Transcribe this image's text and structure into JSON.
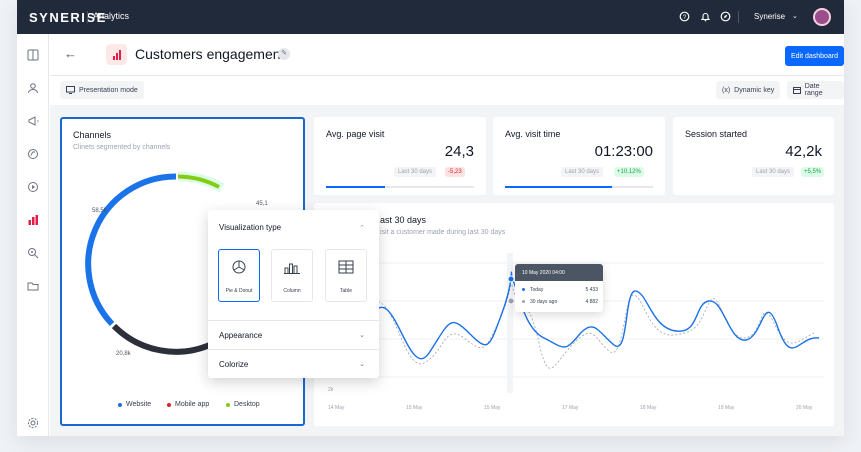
{
  "app": {
    "logo": "SYNERISE",
    "name": "Analytics"
  },
  "topbar": {
    "help_icon": "help-icon",
    "notification_icon": "bell-icon",
    "compass_icon": "compass-icon",
    "user_label": "Synerise",
    "user_chevron": "⌄"
  },
  "sidebar": {
    "items": [
      "dashboard-icon",
      "user-icon",
      "campaign-icon",
      "settings-alt-icon",
      "play-icon",
      "analytics-icon",
      "search-icon",
      "folder-icon",
      "gear-icon"
    ],
    "active_index": 5
  },
  "header": {
    "back_icon": "←",
    "title": "Customers engagement",
    "edit_icon": "✎",
    "edit_dashboard": "Edit dashboard"
  },
  "toolbar": {
    "presentation_mode": "Presentation mode",
    "dynamic_key": "Dynamic key",
    "dynamic_key_icon": "(x)",
    "date_range": "Date range"
  },
  "channels": {
    "title": "Channels",
    "subtitle": "Clinets segmented by channels",
    "labels": {
      "website": "58,5k",
      "desktop": "45,1",
      "mobile": "20,8k"
    },
    "legend": [
      "Website",
      "Mobile app",
      "Desktop"
    ]
  },
  "kpis": [
    {
      "title": "Avg. page visit",
      "value": "24,3",
      "period": "Last 30 days",
      "change": "-5,23",
      "trend": "down",
      "progress": 0.4
    },
    {
      "title": "Avg. visit time",
      "value": "01:23:00",
      "period": "Last 30 days",
      "change": "+10,12%",
      "trend": "up",
      "progress": 0.72
    },
    {
      "title": "Session started",
      "value": "42,2k",
      "period": "Last 30 days",
      "change": "+5,5%",
      "trend": "up",
      "progress": 0
    }
  ],
  "line_chart": {
    "title_fragment": "ast 30 days",
    "subtitle_fragment": "isit a customer made during last 30 days",
    "y_tick": "2k",
    "x_labels": [
      "14 May",
      "15 May",
      "15 May",
      "17 May",
      "18 May",
      "19 May",
      "20 May"
    ]
  },
  "tooltip": {
    "header": "10 May 2020 04:00",
    "rows": [
      {
        "label": "Today",
        "value": "5 433"
      },
      {
        "label": "30 days ago",
        "value": "4 882"
      }
    ]
  },
  "visualization_popup": {
    "title": "Visualization type",
    "chevron_up": "⌃",
    "options": [
      {
        "label": "Pie & Donut",
        "icon": "pie-chart-icon",
        "selected": true
      },
      {
        "label": "Column",
        "icon": "column-chart-icon",
        "selected": false
      },
      {
        "label": "Table",
        "icon": "table-icon",
        "selected": false
      }
    ],
    "appearance": "Appearance",
    "colorize": "Colorize",
    "chevron_down": "⌄"
  },
  "colors": {
    "accent": "#0b68ff",
    "website": "#1a73e8",
    "mobile": "#dc2626",
    "desktop": "#84cc16",
    "dark": "#212a3a"
  }
}
